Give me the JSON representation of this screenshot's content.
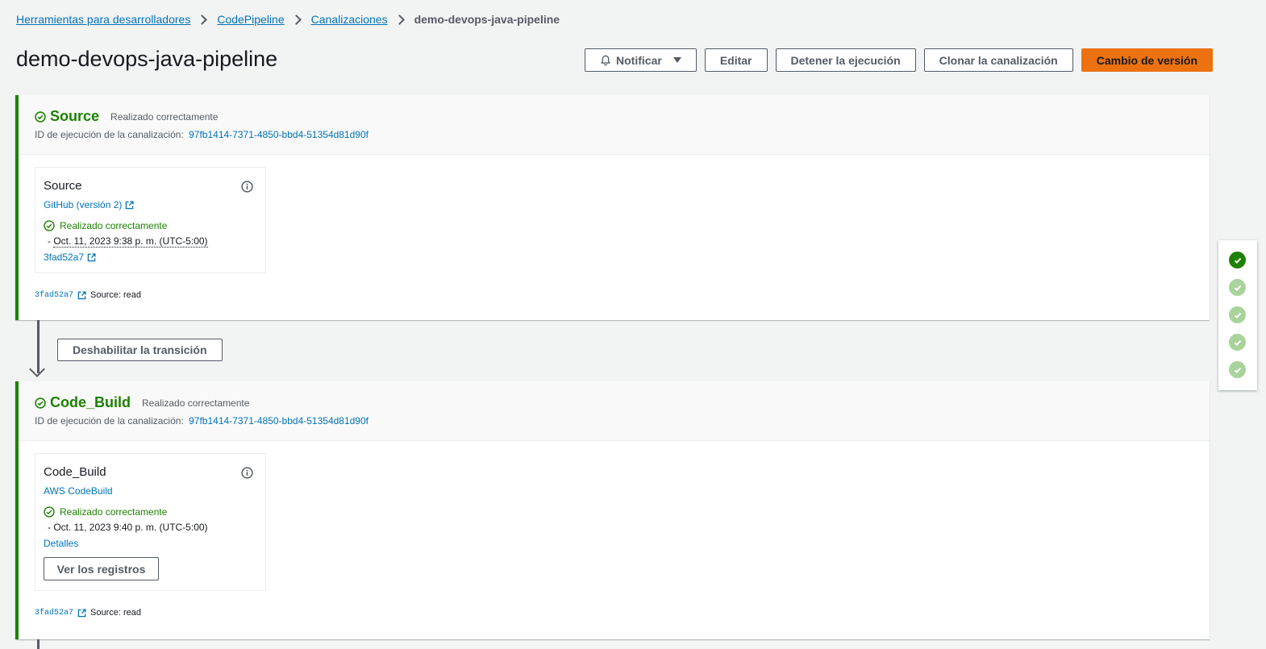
{
  "breadcrumb": {
    "items": [
      "Herramientas para desarrolladores",
      "CodePipeline",
      "Canalizaciones"
    ],
    "current": "demo-devops-java-pipeline"
  },
  "header": {
    "title": "demo-devops-java-pipeline",
    "notify_label": "Notificar",
    "edit_label": "Editar",
    "stop_label": "Detener la ejecución",
    "clone_label": "Clonar la canalización",
    "release_label": "Cambio de versión"
  },
  "stages": [
    {
      "name": "Source",
      "status": "Realizado correctamente",
      "exec_label": "ID de ejecución de la canalización:",
      "exec_id": "97fb1414-7371-4850-bbd4-51354d81d90f",
      "action": {
        "name": "Source",
        "provider": "GitHub (versión 2)",
        "status": "Realizado correctamente",
        "time": "Oct. 11, 2023 9:38 p. m. (UTC-5:00)",
        "link": "3fad52a7"
      },
      "artifact_id": "3fad52a7",
      "artifact_label": "Source: read"
    },
    {
      "name": "Code_Build",
      "status": "Realizado correctamente",
      "exec_label": "ID de ejecución de la canalización:",
      "exec_id": "97fb1414-7371-4850-bbd4-51354d81d90f",
      "action": {
        "name": "Code_Build",
        "provider": "AWS CodeBuild",
        "status": "Realizado correctamente",
        "time": "Oct. 11, 2023 9:40 p. m. (UTC-5:00)",
        "link": "Detalles",
        "logs_label": "Ver los registros"
      },
      "artifact_id": "3fad52a7",
      "artifact_label": "Source: read"
    }
  ],
  "transition": {
    "disable_label": "Deshabilitar la transición"
  },
  "colors": {
    "success": "#1d8102",
    "success_light": "#a8d39b",
    "link": "#0073bb",
    "primary": "#ec7211"
  }
}
